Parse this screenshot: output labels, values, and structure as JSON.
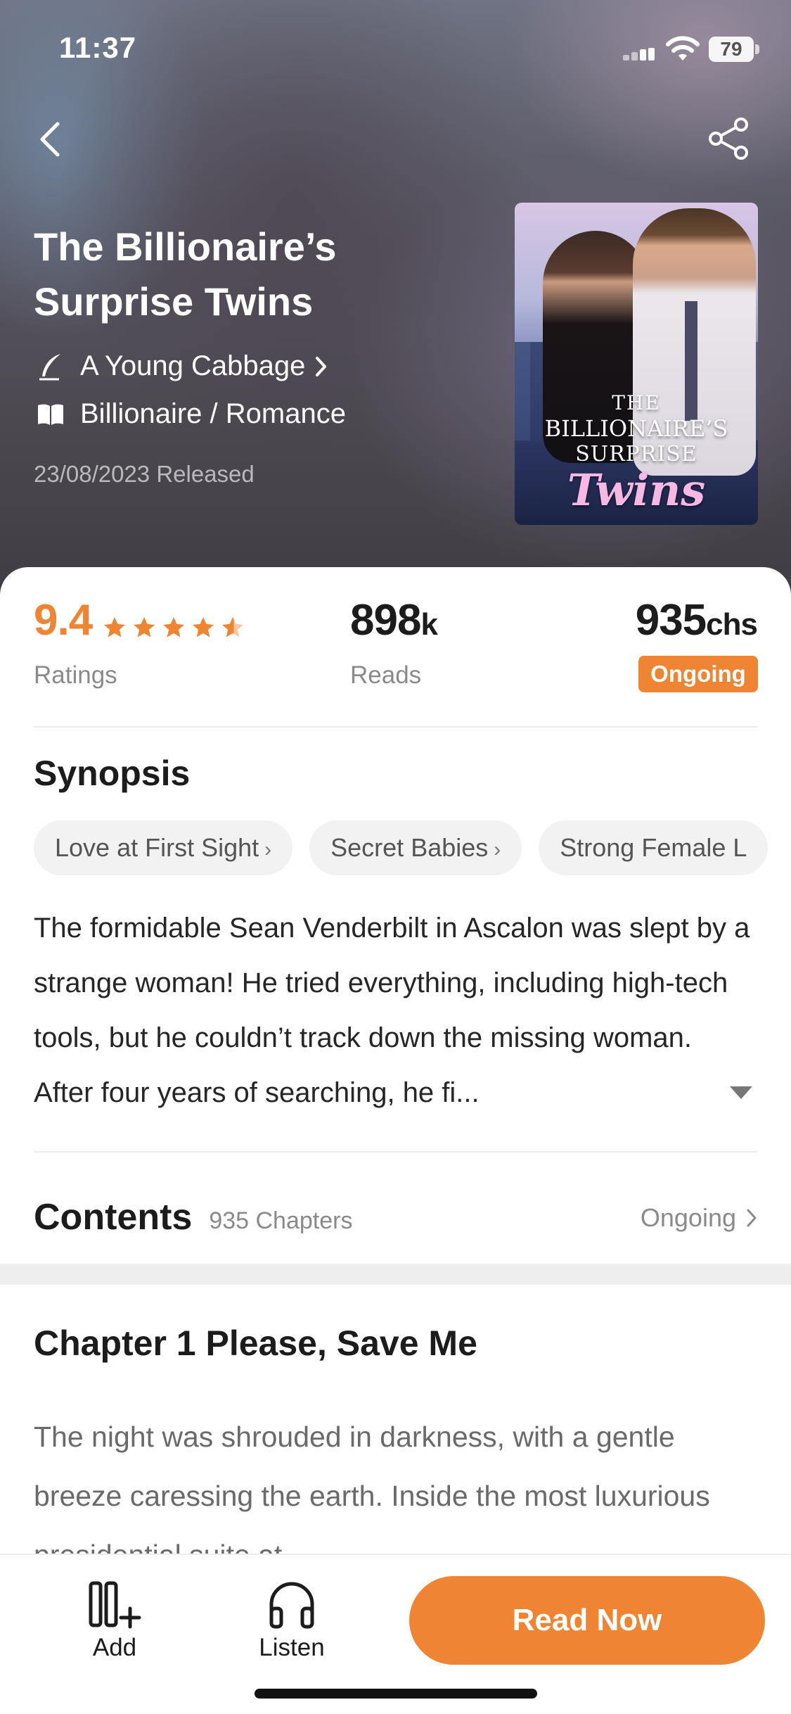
{
  "status_bar": {
    "time": "11:37",
    "battery": "79"
  },
  "header": {
    "back_icon": "chevron-left-icon",
    "share_icon": "share-icon"
  },
  "book": {
    "title": "The Billionaire’s Surprise Twins",
    "author": "A Young Cabbage",
    "genre": "Billionaire / Romance",
    "release": "23/08/2023 Released",
    "cover": {
      "line1": "THE",
      "line2": "BILLIONAIRE’S",
      "line3": "SURPRISE",
      "line4": "Twins"
    }
  },
  "stats": {
    "rating": "9.4",
    "rating_stars": 4.5,
    "ratings_label": "Ratings",
    "reads_number": "898",
    "reads_unit": "k",
    "reads_label": "Reads",
    "chapters_number": "935",
    "chapters_unit": "chs",
    "status_badge": "Ongoing"
  },
  "synopsis": {
    "title": "Synopsis",
    "tags": [
      "Love at First Sight",
      "Secret Babies",
      "Strong Female L"
    ],
    "text": "The formidable Sean Venderbilt in Ascalon was slept by a strange woman! He tried everything, including high-tech tools, but he couldn’t track down the missing woman. After four years of searching, he fi..."
  },
  "contents": {
    "title": "Contents",
    "count": "935 Chapters",
    "status": "Ongoing"
  },
  "chapter_preview": {
    "title": "Chapter 1 Please, Save Me",
    "text": "The night was shrouded in darkness, with a gentle breeze caressing the earth. Inside the most luxurious presidential suite at"
  },
  "bottom_bar": {
    "add_label": "Add",
    "listen_label": "Listen",
    "read_now_label": "Read Now"
  },
  "colors": {
    "accent": "#ef8432",
    "text_primary": "#1c1c1c",
    "text_secondary": "#8a8a8a"
  }
}
